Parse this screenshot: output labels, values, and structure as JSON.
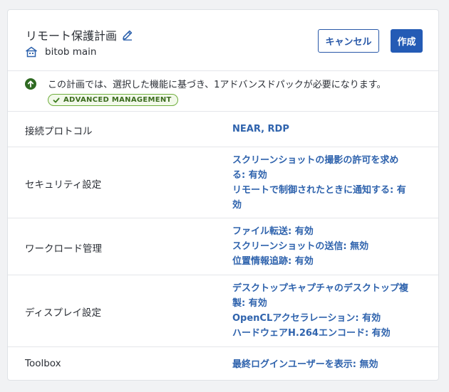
{
  "header": {
    "title": "リモート保護計画",
    "subtitle": "bitob main",
    "cancel_label": "キャンセル",
    "create_label": "作成"
  },
  "notice": {
    "text": "この計画では、選択した機能に基づき、1アドバンスドパックが必要になります。",
    "badge": "ADVANCED MANAGEMENT"
  },
  "rows": [
    {
      "label": "接続プロトコル",
      "values": [
        "NEAR, RDP"
      ]
    },
    {
      "label": "セキュリティ設定",
      "values": [
        "スクリーンショットの撮影の許可を求め",
        "る: 有効",
        "リモートで制御されたときに通知する: 有",
        "効"
      ]
    },
    {
      "label": "ワークロード管理",
      "values": [
        "ファイル転送: 有効",
        "スクリーンショットの送信: 無効",
        "位置情報追跡: 有効"
      ]
    },
    {
      "label": "ディスプレイ設定",
      "values": [
        "デスクトップキャプチャのデスクトップ複",
        "製: 有効",
        "OpenCLアクセラレーション: 有効",
        "ハードウェアH.264エンコード: 有効"
      ]
    },
    {
      "label": "Toolbox",
      "values": [
        "最終ログインユーザーを表示: 無効"
      ]
    }
  ],
  "colors": {
    "accent": "#245bb5",
    "link": "#2f63ad",
    "success": "#2f7d1d"
  }
}
